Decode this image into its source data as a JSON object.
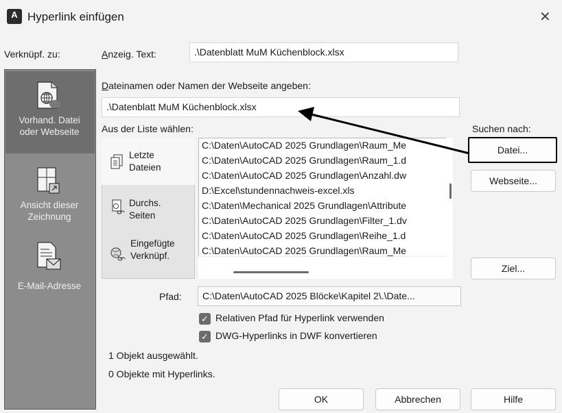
{
  "window": {
    "title": "Hyperlink einfügen",
    "close_glyph": "✕",
    "app_icon_letter": "A"
  },
  "left_nav": {
    "label": "Verknüpf. zu:",
    "items": [
      {
        "line1": "Vorhand. Datei",
        "line2": "oder Webseite",
        "icon": "globe-file-icon",
        "selected": true
      },
      {
        "line1": "Ansicht dieser",
        "line2": "Zeichnung",
        "icon": "drawing-view-icon",
        "selected": false
      },
      {
        "line1": "E-Mail-Adresse",
        "line2": "",
        "icon": "email-icon",
        "selected": false
      }
    ]
  },
  "display_text": {
    "label": "Anzeig. Text:",
    "value": ".\\Datenblatt MuM Küchenblock.xlsx"
  },
  "filename": {
    "label": "Dateinamen oder Namen der Webseite angeben:",
    "value": ".\\Datenblatt MuM Küchenblock.xlsx"
  },
  "list_section": {
    "label": "Aus der Liste wählen:",
    "tabs": [
      {
        "line1": "Letzte",
        "line2": "Dateien",
        "icon": "recent-files-icon",
        "active": true
      },
      {
        "line1": "Durchs.",
        "line2": "Seiten",
        "icon": "browsed-pages-icon",
        "active": false
      },
      {
        "line1": "Eingefügte",
        "line2": "Verknüpf.",
        "icon": "inserted-links-icon",
        "active": false
      }
    ],
    "items": [
      "C:\\Daten\\AutoCAD 2025 Grundlagen\\Raum_Me",
      "C:\\Daten\\AutoCAD 2025 Grundlagen\\Raum_1.d",
      "C:\\Daten\\AutoCAD 2025 Grundlagen\\Anzahl.dw",
      "D:\\Excel\\stundennachweis-excel.xls",
      "C:\\Daten\\Mechanical 2025 Grundlagen\\Attribute",
      "C:\\Daten\\AutoCAD 2025 Grundlagen\\Filter_1.dv",
      "C:\\Daten\\AutoCAD 2025 Grundlagen\\Reihe_1.d",
      "C:\\Daten\\AutoCAD 2025 Grundlagen\\Raum_Me"
    ]
  },
  "browse": {
    "label": "Suchen nach:",
    "file_button": "Datei...",
    "web_button": "Webseite...",
    "target_button": "Ziel..."
  },
  "path": {
    "label": "Pfad:",
    "value": "C:\\Daten\\AutoCAD 2025 Blöcke\\Kapitel 2\\.\\Date..."
  },
  "options": {
    "relative_path": "Relativen Pfad für Hyperlink verwenden",
    "dwg_convert": "DWG-Hyperlinks in DWF konvertieren"
  },
  "status": {
    "selected": "1 Objekt ausgewählt.",
    "with_links": "0 Objekte mit Hyperlinks."
  },
  "footer": {
    "ok": "OK",
    "cancel": "Abbrechen",
    "help": "Hilfe"
  },
  "colors": {
    "nav_bg": "#8c8c8c",
    "nav_selected": "#6e6e6e",
    "checkbox": "#6b6b6b",
    "callout": "#000000"
  }
}
